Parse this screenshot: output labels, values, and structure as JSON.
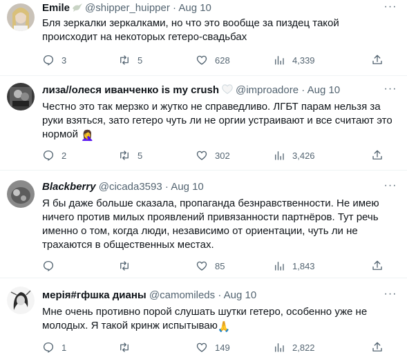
{
  "tweets": [
    {
      "name": "Emile",
      "handle": "@shipper_huipper",
      "date": "Aug 10",
      "text": "Бля зеркалки зеркалками, но что это вообще за пиздец такой происходит на некоторых гетеро-свадьбах",
      "replies": "3",
      "retweets": "5",
      "likes": "628",
      "views": "4,339"
    },
    {
      "name": "лиза//олеся иванченко is my crush",
      "handle": "@improadore",
      "date": "Aug 10",
      "text": "Честно это так мерзко и жутко не справедливо. ЛГБТ парам нельзя за руки взяться, зато гетеро чуть ли не оргии устраивают и все считают это нормой",
      "emoji": "🤦‍♀️",
      "replies": "2",
      "retweets": "5",
      "likes": "302",
      "views": "3,426"
    },
    {
      "name": "Blackberry",
      "handle": "@cicada3593",
      "date": "Aug 10",
      "text": "Я бы даже больше сказала, пропаганда безнравственности. Не имею ничего против милых проявлений привязанности партнёров. Тут речь именно о том, когда люди, независимо от ориентации, чуть ли не трахаются в общественных местах.",
      "replies": "",
      "retweets": "",
      "likes": "85",
      "views": "1,843"
    },
    {
      "name": "мерія#гфшка дианы",
      "handle": "@camomileds",
      "date": "Aug 10",
      "text": "Мне очень противно порой слушать шутки гетеро, особенно уже не молодых. Я такой кринж испытываю",
      "emoji": "🙏",
      "replies": "1",
      "retweets": "",
      "likes": "149",
      "views": "2,822"
    }
  ],
  "separator": "·",
  "colors": {
    "text": "#0f1419",
    "muted": "#536471",
    "divider": "#eff3f4"
  }
}
